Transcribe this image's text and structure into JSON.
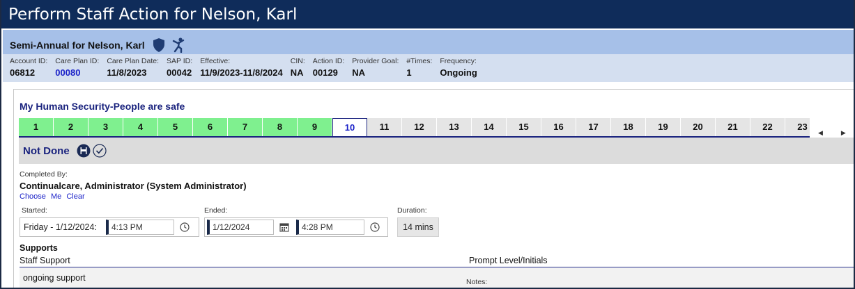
{
  "window": {
    "title": "Perform Staff Action for Nelson, Karl"
  },
  "subheader": {
    "title": "Semi-Annual for Nelson, Karl"
  },
  "info": [
    {
      "label": "Account ID:",
      "value": "06812",
      "link": false
    },
    {
      "label": "Care Plan ID:",
      "value": "00080",
      "link": true
    },
    {
      "label": "Care Plan Date:",
      "value": "11/8/2023",
      "link": false
    },
    {
      "label": "SAP ID:",
      "value": "00042",
      "link": false
    },
    {
      "label": "Effective:",
      "value": "11/9/2023-11/8/2024",
      "link": false
    },
    {
      "label": "CIN:",
      "value": "NA",
      "link": false
    },
    {
      "label": "Action ID:",
      "value": "00129",
      "link": false
    },
    {
      "label": "Provider Goal:",
      "value": "NA",
      "link": false
    },
    {
      "label": "#Times:",
      "value": "1",
      "link": false
    },
    {
      "label": "Frequency:",
      "value": "Ongoing",
      "link": false
    }
  ],
  "goal": {
    "title": "My Human Security-People are safe"
  },
  "days": {
    "labels": [
      "1",
      "2",
      "3",
      "4",
      "5",
      "6",
      "7",
      "8",
      "9",
      "10",
      "11",
      "12",
      "13",
      "14",
      "15",
      "16",
      "17",
      "18",
      "19",
      "20",
      "21",
      "22",
      "23"
    ],
    "done_count": 9,
    "current": "10"
  },
  "status": {
    "label": "Not Done"
  },
  "completed": {
    "label": "Completed By:",
    "value": "Continualcare, Administrator (System Administrator)",
    "links": {
      "choose": "Choose",
      "me": "Me",
      "clear": "Clear"
    }
  },
  "started": {
    "label": "Started:",
    "date": "Friday - 1/12/2024:",
    "time": "4:13 PM"
  },
  "ended": {
    "label": "Ended:",
    "date": "1/12/2024",
    "time": "4:28 PM"
  },
  "duration": {
    "label": "Duration:",
    "value": "14 mins"
  },
  "supports": {
    "title": "Supports",
    "col_staff": "Staff Support",
    "col_prompt": "Prompt Level/Initials",
    "row_text": "ongoing support",
    "notes_label": "Notes:"
  },
  "colors": {
    "title_bg": "#0f2c5a",
    "sub_bg": "#a6c0e8",
    "info_bg": "#d4dff0",
    "done": "#7ff08f",
    "future": "#e5e5e5",
    "accent": "#1a237e"
  }
}
